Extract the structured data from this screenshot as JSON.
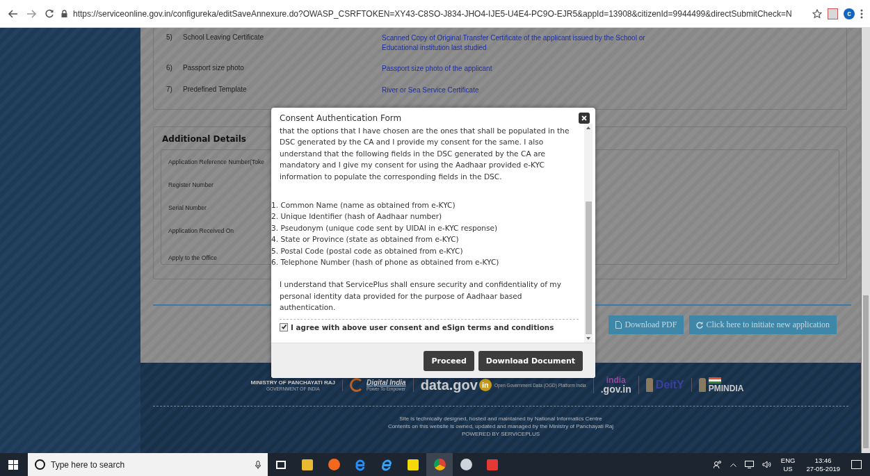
{
  "browser": {
    "url": "https://serviceonline.gov.in/configureka/editSaveAnnexure.do?OWASP_CSRFTOKEN=XY43-C8SO-J834-JHO4-IJE5-U4E4-PC9O-EJR5&appId=13908&citizenId=9944499&directSubmitCheck=N",
    "profile_initial": "c"
  },
  "documents": [
    {
      "number": "5)",
      "name": "School Leaving Certificate",
      "description": "Scanned Copy of Original Transfer Certificate of the applicant issued by the School or Educational institution last studied"
    },
    {
      "number": "6)",
      "name": "Passport size photo",
      "description": "Passport size photo of the applicant"
    },
    {
      "number": "7)",
      "name": "Predefined Template",
      "description": "River or Sea Service Certificate"
    }
  ],
  "additional_details": {
    "title": "Additional Details",
    "fields": [
      "Application Reference Number(Toke",
      "Register Number",
      "Serial Number",
      "Application Received On",
      "Apply to the Office"
    ]
  },
  "actions": [
    "Download PDF",
    "Click here to initiate new application"
  ],
  "modal": {
    "title": "Consent Authentication Form",
    "intro": "that the options that I have chosen are the ones that shall be populated in the DSC generated by the CA and I provide my consent for the same. I also understand that the following fields in the DSC generated by the CA are mandatory and I give my consent for using the Aadhaar provided e-KYC information to populate the corresponding fields in the DSC.",
    "fields": [
      "1. Common Name (name as obtained from e-KYC)",
      "2. Unique Identifier (hash of Aadhaar number)",
      "3. Pseudonym (unique code sent by UIDAI in e-KYC response)",
      "4. State or Province (state as obtained from e-KYC)",
      "5. Postal Code (postal code as obtained from e-KYC)",
      "6. Telephone Number (hash of phone as obtained from e-KYC)"
    ],
    "closing": "I understand that ServicePlus shall ensure security and confidentiality of my personal identity data provided for the purpose of Aadhaar based authentication.",
    "agree": {
      "label": "I agree with above user consent and eSign terms and conditions",
      "checked": true
    },
    "buttons": [
      "Proceed",
      "Download Document"
    ]
  },
  "footer": {
    "logos": [
      {
        "kind": "ministry",
        "text": "MINISTRY OF PANCHAYATI RAJ",
        "subtext": "GOVERNMENT OF INDIA"
      },
      {
        "kind": "digital",
        "text": "Digital India",
        "subtext": "Power To Empower"
      },
      {
        "kind": "datagov",
        "text": "data.gov",
        "badge": "in",
        "subtext": "Open Government Data (OGD) Platform India"
      },
      {
        "kind": "indiagov",
        "text": "india",
        "subtext": ".gov.in"
      },
      {
        "kind": "deity",
        "text": "DeitY"
      },
      {
        "kind": "pmindia",
        "text": "PMINDIA"
      }
    ],
    "lines": [
      "Site is technically designed, hosted and maintained by National Informatics Centre",
      "Contents on this website is owned, updated and managed by the Ministry of Panchayati Raj",
      "POWERED BY SERVICEPLUS"
    ]
  },
  "taskbar": {
    "search_placeholder": "Type here to search",
    "language": "ENG",
    "region": "US",
    "time": "13:46",
    "date": "27-05-2019"
  }
}
